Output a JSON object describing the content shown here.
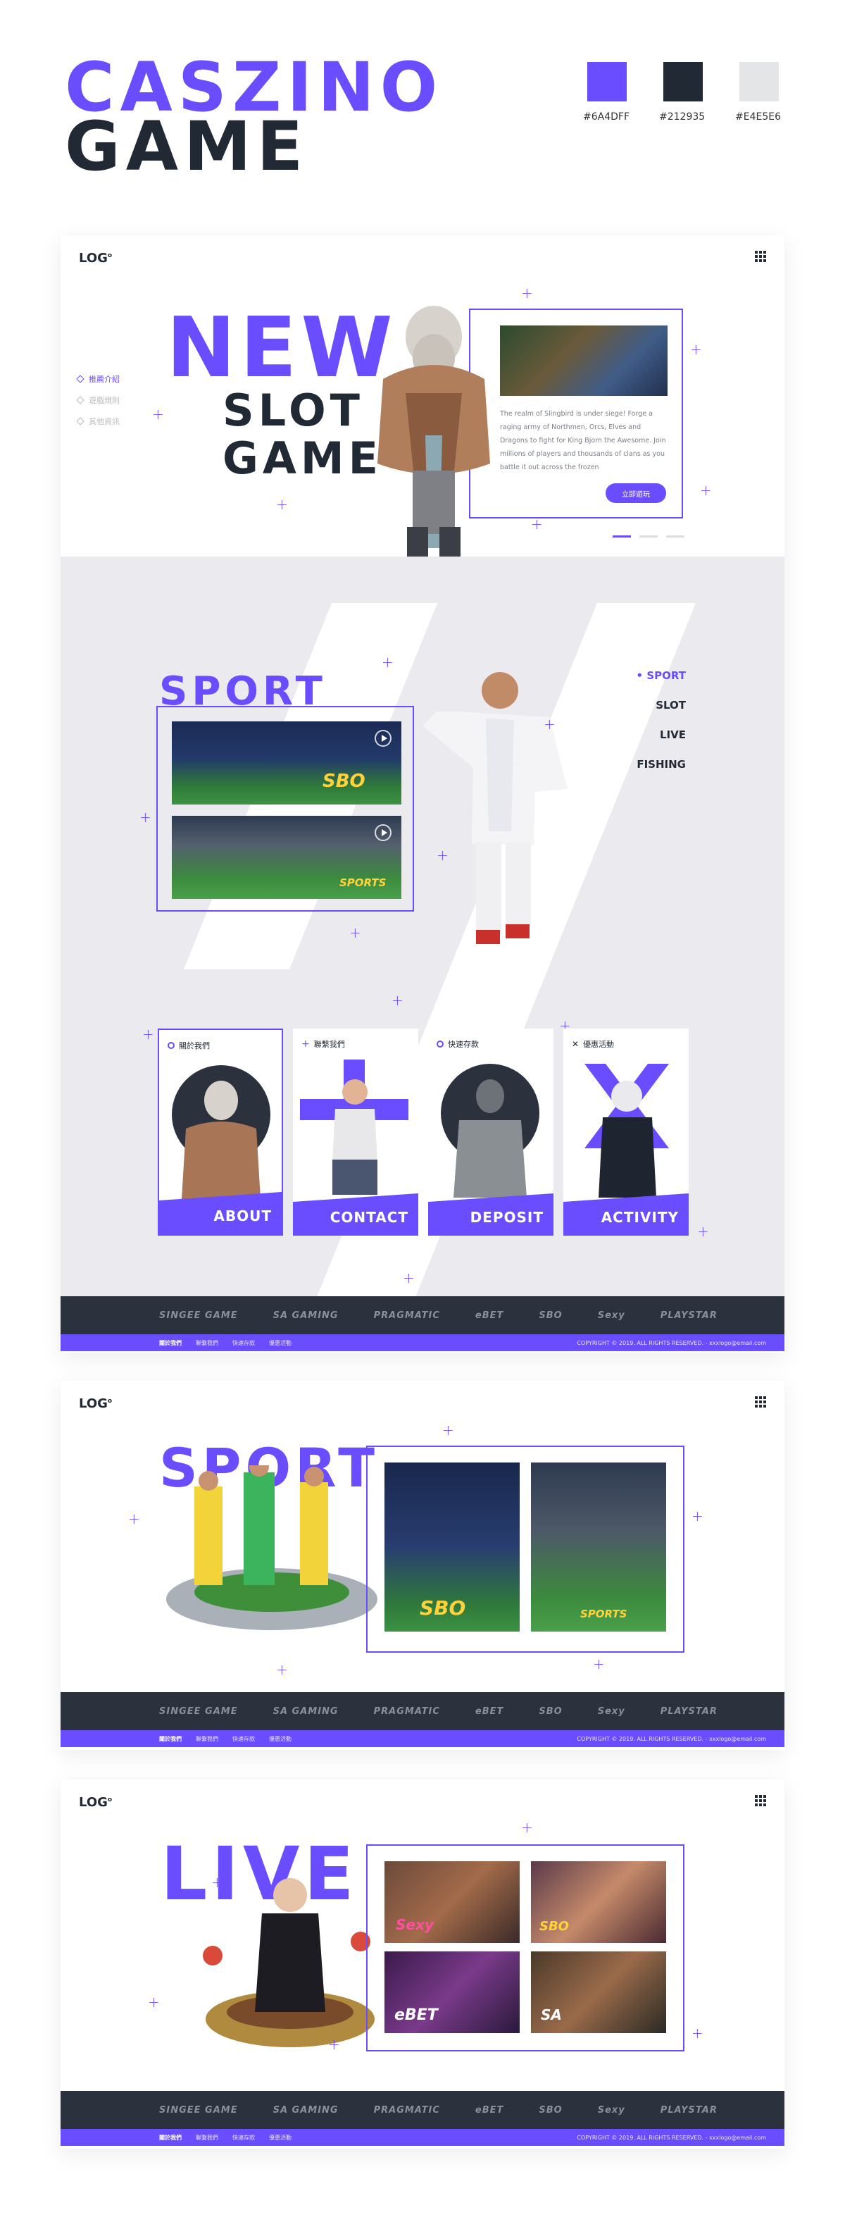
{
  "header": {
    "title_line1": "CASZINO",
    "title_line2": "GAME",
    "swatches": [
      {
        "color": "#6A4DFF",
        "label": "#6A4DFF"
      },
      {
        "color": "#212935",
        "label": "#212935"
      },
      {
        "color": "#E4E5E6",
        "label": "#E4E5E6"
      }
    ]
  },
  "logo": "LOG",
  "logo_mark": "o",
  "panel1": {
    "side_nav": [
      "推薦介紹",
      "遊戲規則",
      "其他資訊"
    ],
    "word_new": "NEW",
    "word_slot": "SLOT",
    "word_game": "GAME",
    "description": "The realm of Slingbird is under siege! Forge a raging army of Northmen, Orcs, Elves and Dragons to fight for King Bjorn the Awesome. Join millions of players and thousands of clans as you battle it out across the frozen",
    "cta": "立即遊玩",
    "word_sport": "SPORT",
    "sport_menu": [
      "• SPORT",
      "SLOT",
      "LIVE",
      "FISHING"
    ],
    "thumbs": [
      {
        "badge": "SBO",
        "sub": "SBO"
      },
      {
        "badge": "SPORTS",
        "sub": "SPORTS"
      }
    ],
    "cards": [
      {
        "title": "關於我們",
        "label": "ABOUT"
      },
      {
        "title": "聯繫我們",
        "label": "CONTACT"
      },
      {
        "title": "快速存款",
        "label": "DEPOSIT"
      },
      {
        "title": "優惠活動",
        "label": "ACTIVITY"
      }
    ]
  },
  "panel2": {
    "word_sport": "SPORT",
    "thumbs": [
      {
        "badge": "SBO"
      },
      {
        "badge": "SPORTS"
      }
    ]
  },
  "panel3": {
    "word_live": "LIVE",
    "thumbs": [
      {
        "badge": "Sexy"
      },
      {
        "badge": "SBO"
      },
      {
        "badge": "eBET"
      },
      {
        "badge": "SA"
      }
    ]
  },
  "footer": {
    "partners": [
      "SINGEE GAME",
      "SA GAMING",
      "PRAGMATIC",
      "eBET",
      "SBO",
      "Sexy",
      "PLAYSTAR"
    ],
    "links": [
      "關於我們",
      "聯繫我們",
      "快速存款",
      "優惠活動"
    ],
    "copyright": "COPYRIGHT © 2019. ALL RIGHTS RESERVED. - xxxlogo@email.com"
  }
}
